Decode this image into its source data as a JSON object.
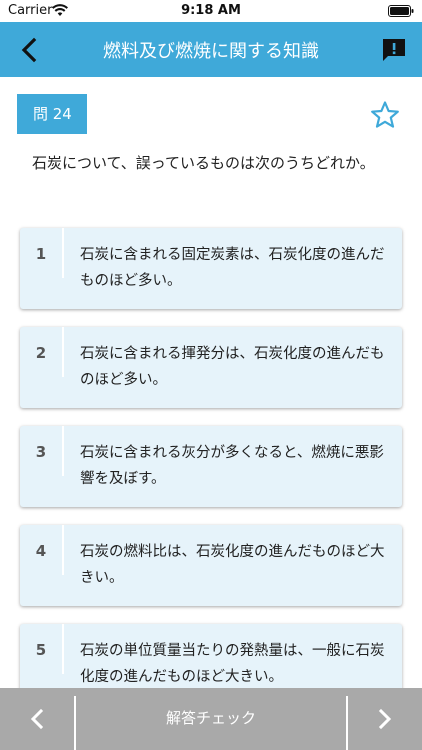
{
  "status": {
    "carrier": "Carrier",
    "time": "9:18 AM"
  },
  "header": {
    "title": "燃料及び燃焼に関する知識",
    "back_icon": "chevron-left-icon",
    "report_icon": "feedback-icon"
  },
  "question": {
    "badge": "問 24",
    "text": "石炭について、誤っているものは次のうちどれか。",
    "favorite_icon": "star-outline-icon"
  },
  "choices": [
    {
      "number": "1",
      "text": "石炭に含まれる固定炭素は、石炭化度の進んだものほど多い。"
    },
    {
      "number": "2",
      "text": "石炭に含まれる揮発分は、石炭化度の進んだものほど多い。"
    },
    {
      "number": "3",
      "text": "石炭に含まれる灰分が多くなると、燃焼に悪影響を及ぼす。"
    },
    {
      "number": "4",
      "text": "石炭の燃料比は、石炭化度の進んだものほど大きい。"
    },
    {
      "number": "5",
      "text": "石炭の単位質量当たりの発熱量は、一般に石炭化度の進んだものほど大きい。"
    }
  ],
  "footer": {
    "check_label": "解答チェック"
  },
  "colors": {
    "primary": "#3fa9d9",
    "choice_bg": "#e6f3fa",
    "bottom_bar": "#a9a9a9"
  }
}
